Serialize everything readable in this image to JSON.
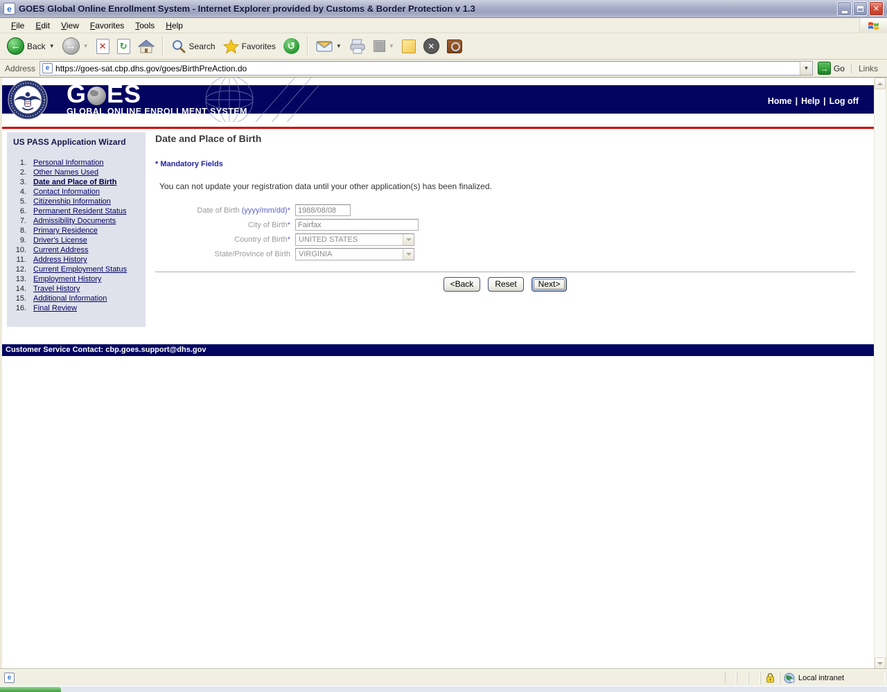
{
  "colors": {
    "navy": "#020460",
    "red_line": "#cc0000",
    "link": "#000066",
    "go_green": "#2f9e38"
  },
  "window": {
    "title": "GOES Global Online Enrollment System - Internet Explorer provided by Customs & Border Protection v 1.3"
  },
  "menu_bar": {
    "items": [
      "File",
      "Edit",
      "View",
      "Favorites",
      "Tools",
      "Help"
    ]
  },
  "toolbar": {
    "back_label": "Back",
    "search_label": "Search",
    "favorites_label": "Favorites"
  },
  "address_bar": {
    "label": "Address",
    "url": "https://goes-sat.cbp.dhs.gov/goes/BirthPreAction.do",
    "go_label": "Go",
    "links_label": "Links"
  },
  "site_header": {
    "logo_part1": "G",
    "logo_part2": "ES",
    "logo_subtitle": "GLOBAL ONLINE ENROLLMENT SYSTEM",
    "nav": {
      "home": "Home",
      "help": "Help",
      "logoff": "Log off",
      "separator": "|"
    }
  },
  "sidebar": {
    "title": "US PASS Application Wizard",
    "items": [
      {
        "num": "1.",
        "label": "Personal Information"
      },
      {
        "num": "2.",
        "label": "Other Names Used"
      },
      {
        "num": "3.",
        "label": "Date and Place of Birth"
      },
      {
        "num": "4.",
        "label": "Contact Information"
      },
      {
        "num": "5.",
        "label": "Citizenship Information"
      },
      {
        "num": "6.",
        "label": "Permanent Resident Status"
      },
      {
        "num": "7.",
        "label": "Admissibility Documents"
      },
      {
        "num": "8.",
        "label": "Primary Residence"
      },
      {
        "num": "9.",
        "label": "Driver's License"
      },
      {
        "num": "10.",
        "label": "Current Address"
      },
      {
        "num": "11.",
        "label": "Address History"
      },
      {
        "num": "12.",
        "label": "Current Employment Status"
      },
      {
        "num": "13.",
        "label": "Employment History"
      },
      {
        "num": "14.",
        "label": "Travel History"
      },
      {
        "num": "15.",
        "label": "Additional Information"
      },
      {
        "num": "16.",
        "label": "Final Review"
      }
    ]
  },
  "main": {
    "heading": "Date and Place of Birth",
    "mandatory_note": "* Mandatory Fields",
    "info_message": "You can not update your registration data until your other application(s) has been finalized.",
    "fields": [
      {
        "label": "Date of Birth ",
        "suffix": "(yyyy/mm/dd)*",
        "value": "1988/08/08"
      },
      {
        "label": "City of Birth",
        "suffix": "*",
        "value": "Fairfax"
      },
      {
        "label": "Country of Birth",
        "suffix": "*",
        "value": "UNITED STATES"
      },
      {
        "label": "State/Province of Birth",
        "suffix": "",
        "value": "VIRGINIA"
      }
    ],
    "buttons": {
      "back": "<Back",
      "reset": "Reset",
      "next": "Next>"
    }
  },
  "footer": {
    "contact": "Customer Service Contact: cbp.goes.support@dhs.gov"
  },
  "status_bar": {
    "zone": "Local intranet"
  }
}
